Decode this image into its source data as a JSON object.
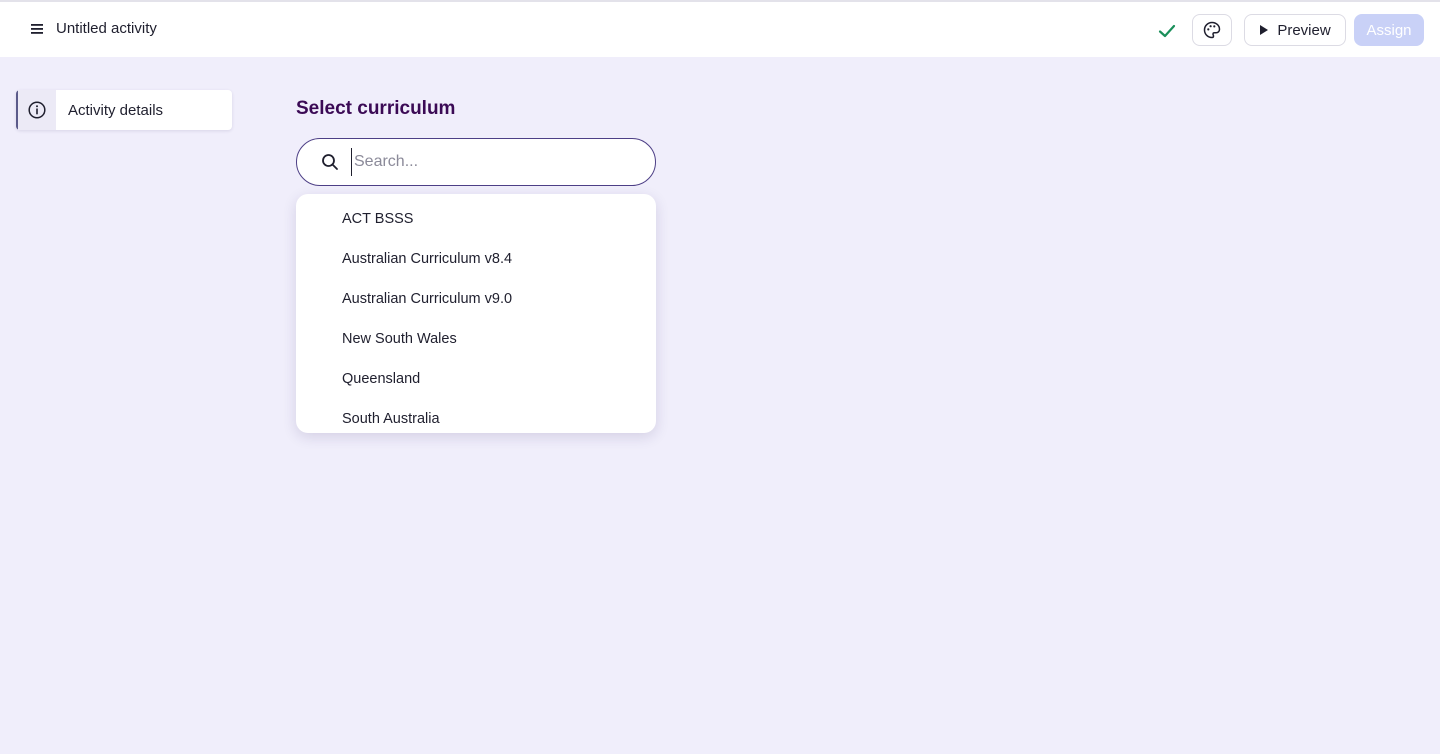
{
  "header": {
    "title": "Untitled activity",
    "menu_icon": "hamburger-menu-icon",
    "saved_icon": "checkmark-icon",
    "theme_icon": "palette-icon",
    "preview_label": "Preview",
    "preview_icon": "play-icon",
    "assign_label": "Assign"
  },
  "sidebar": {
    "items": [
      {
        "label": "Activity details",
        "icon": "info-icon"
      }
    ]
  },
  "main": {
    "section_title": "Select curriculum",
    "search": {
      "placeholder": "Search...",
      "value": ""
    },
    "options": [
      "ACT BSSS",
      "Australian Curriculum v8.4",
      "Australian Curriculum v9.0",
      "New South Wales",
      "Queensland",
      "South Australia"
    ]
  },
  "colors": {
    "background": "#f0eefb",
    "accent": "#3b0a55",
    "success": "#1a8f5a",
    "assign_disabled": "#c9d1f7"
  }
}
